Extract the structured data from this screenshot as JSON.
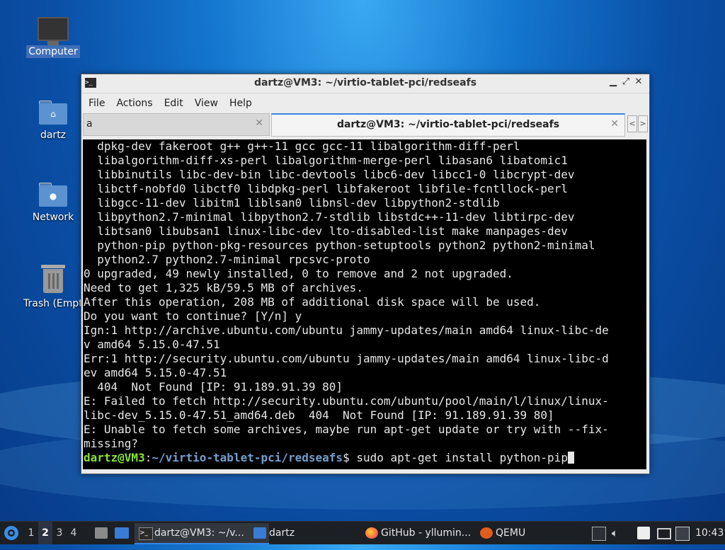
{
  "desktop": {
    "icons": [
      {
        "label": "Computer"
      },
      {
        "label": "dartz"
      },
      {
        "label": "Network"
      },
      {
        "label": "Trash (Empty)"
      }
    ]
  },
  "window": {
    "title": "dartz@VM3: ~/virtio-tablet-pci/redseafs",
    "menu": [
      "File",
      "Actions",
      "Edit",
      "View",
      "Help"
    ],
    "tabs": [
      {
        "label": "a"
      },
      {
        "label": "dartz@VM3: ~/virtio-tablet-pci/redseafs"
      }
    ]
  },
  "terminal": {
    "lines": [
      "  dpkg-dev fakeroot g++ g++-11 gcc gcc-11 libalgorithm-diff-perl",
      "  libalgorithm-diff-xs-perl libalgorithm-merge-perl libasan6 libatomic1",
      "  libbinutils libc-dev-bin libc-devtools libc6-dev libcc1-0 libcrypt-dev",
      "  libctf-nobfd0 libctf0 libdpkg-perl libfakeroot libfile-fcntllock-perl",
      "  libgcc-11-dev libitm1 liblsan0 libnsl-dev libpython2-stdlib",
      "  libpython2.7-minimal libpython2.7-stdlib libstdc++-11-dev libtirpc-dev",
      "  libtsan0 libubsan1 linux-libc-dev lto-disabled-list make manpages-dev",
      "  python-pip python-pkg-resources python-setuptools python2 python2-minimal",
      "  python2.7 python2.7-minimal rpcsvc-proto",
      "0 upgraded, 49 newly installed, 0 to remove and 2 not upgraded.",
      "Need to get 1,325 kB/59.5 MB of archives.",
      "After this operation, 208 MB of additional disk space will be used.",
      "Do you want to continue? [Y/n] y",
      "Ign:1 http://archive.ubuntu.com/ubuntu jammy-updates/main amd64 linux-libc-de",
      "v amd64 5.15.0-47.51",
      "Err:1 http://security.ubuntu.com/ubuntu jammy-updates/main amd64 linux-libc-d",
      "ev amd64 5.15.0-47.51",
      "  404  Not Found [IP: 91.189.91.39 80]",
      "E: Failed to fetch http://security.ubuntu.com/ubuntu/pool/main/l/linux/linux-",
      "libc-dev_5.15.0-47.51_amd64.deb  404  Not Found [IP: 91.189.91.39 80]",
      "E: Unable to fetch some archives, maybe run apt-get update or try with --fix-",
      "missing?"
    ],
    "prompt_user": "dartz@VM3",
    "prompt_sep": ":",
    "prompt_path": "~/virtio-tablet-pci/redseafs",
    "prompt_symbol": "$ ",
    "command": "sudo apt-get install python-pip"
  },
  "taskbar": {
    "workspaces": [
      "1",
      "2",
      "3",
      "4"
    ],
    "active_workspace": "2",
    "tasks": [
      {
        "label": "dartz@VM3: ~/v...",
        "icon": "terminal-icon"
      },
      {
        "label": "dartz",
        "icon": "folder-icon"
      },
      {
        "label": "GitHub - yllumin...",
        "icon": "firefox-icon"
      },
      {
        "label": "QEMU",
        "icon": "qemu-icon"
      }
    ],
    "clock": "10:43"
  }
}
